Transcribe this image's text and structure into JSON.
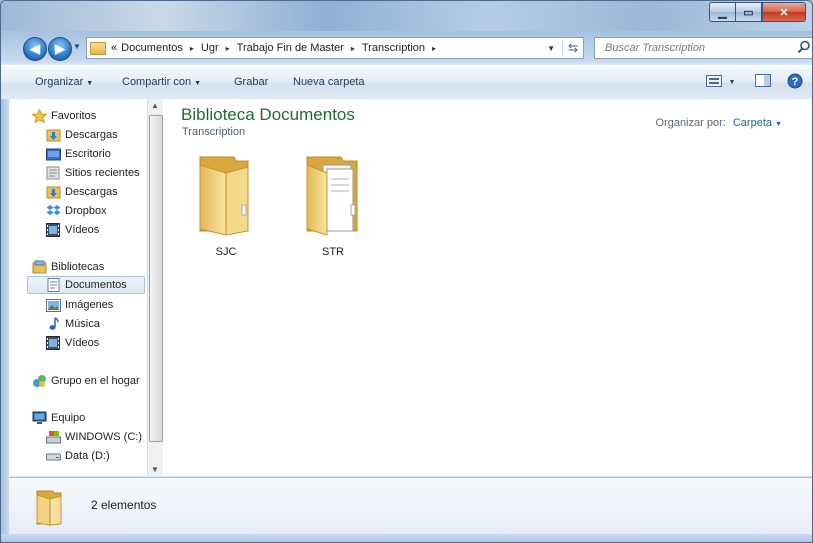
{
  "window": {
    "caption_buttons": {
      "minimize_icon": "minimize-icon",
      "maximize_icon": "maximize-icon",
      "close_icon": "close-icon"
    }
  },
  "address_bar": {
    "overflow": "«",
    "breadcrumbs": [
      "Documentos",
      "Ugr",
      "Trabajo Fin de Master",
      "Transcription"
    ],
    "separator": "▸"
  },
  "search": {
    "placeholder": "Buscar Transcription"
  },
  "toolbar": {
    "organize": "Organizar",
    "share": "Compartir con",
    "burn": "Grabar",
    "new_folder": "Nueva carpeta"
  },
  "nav": {
    "favorites_header": "Favoritos",
    "favorites": [
      "Descargas",
      "Escritorio",
      "Sitios recientes",
      "Descargas",
      "Dropbox",
      "Vídeos"
    ],
    "libraries_header": "Bibliotecas",
    "libraries": [
      "Documentos",
      "Imágenes",
      "Música",
      "Vídeos"
    ],
    "homegroup": "Grupo en el hogar",
    "computer_header": "Equipo",
    "drives": [
      "WINDOWS (C:)",
      "Data (D:)"
    ],
    "selected": "Documentos"
  },
  "content": {
    "library_title": "Biblioteca Documentos",
    "library_subtitle": "Transcription",
    "arrange_label": "Organizar por:",
    "arrange_value": "Carpeta",
    "items": [
      {
        "name": "SJC",
        "icon": "empty-folder-icon"
      },
      {
        "name": "STR",
        "icon": "documents-folder-icon"
      }
    ]
  },
  "details": {
    "count": "2 elementos"
  },
  "colors": {
    "library_title": "#1f6c31",
    "accent_link": "#1f5fa7",
    "close_button": "#c43b1c"
  }
}
